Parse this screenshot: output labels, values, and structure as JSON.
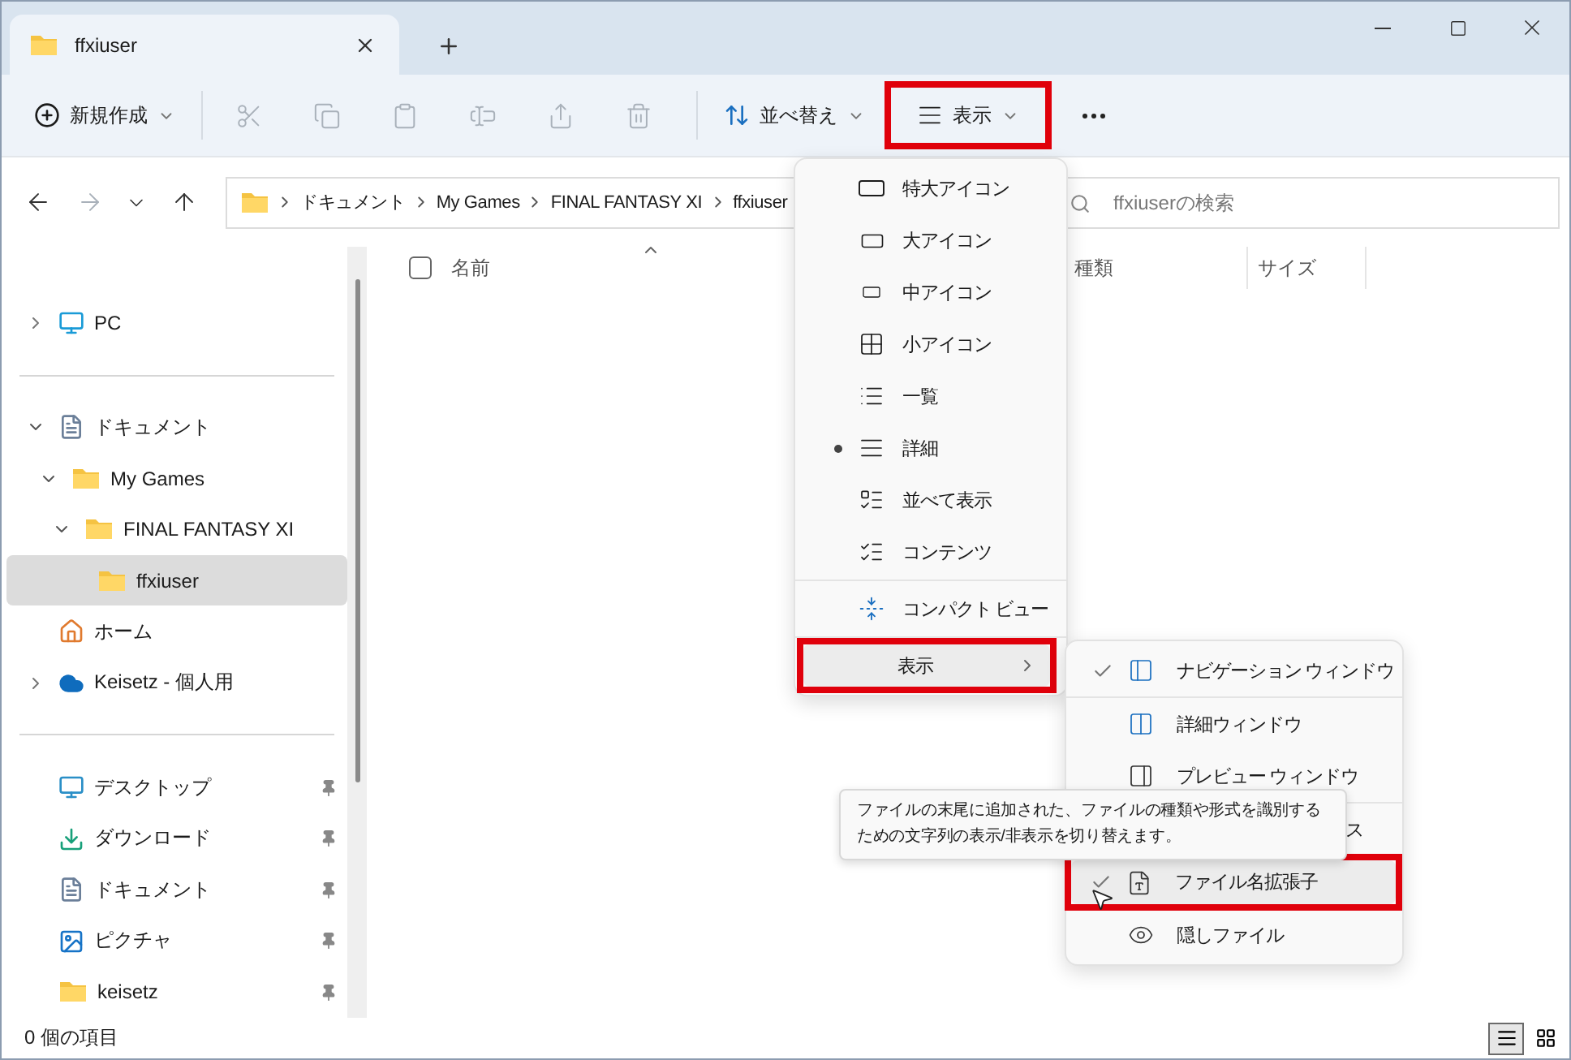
{
  "window": {
    "tab_title": "ffxiuser"
  },
  "toolbar": {
    "new_label": "新規作成",
    "actions": [
      {
        "disabled": true
      },
      {
        "disabled": true
      },
      {
        "disabled": true
      },
      {
        "disabled": true
      },
      {
        "disabled": true
      },
      {
        "disabled": true
      }
    ],
    "sort_label": "並べ替え",
    "view_label": "表示",
    "view_annotated": true
  },
  "address": {
    "crumbs": [
      "ドキュメント",
      "My Games",
      "FINAL FANTASY XI",
      "ffxiuser"
    ]
  },
  "search": {
    "placeholder": "ffxiuserの検索"
  },
  "sidebar": {
    "groups": [
      [
        {
          "kind": "pc",
          "label": "PC",
          "expanded": false,
          "selected": false
        }
      ],
      [
        {
          "kind": "documents",
          "label": "ドキュメント",
          "expanded": true,
          "selected": false,
          "children": [
            {
              "kind": "folder",
              "label": "My Games",
              "expanded": true,
              "selected": false,
              "children": [
                {
                  "kind": "folder",
                  "label": "FINAL FANTASY XI",
                  "expanded": true,
                  "selected": false,
                  "children": [
                    {
                      "kind": "folder",
                      "label": "ffxiuser",
                      "selected": true
                    }
                  ]
                }
              ]
            }
          ]
        },
        {
          "kind": "home",
          "label": "ホーム",
          "selected": false
        },
        {
          "kind": "cloud",
          "label": "Keisetz - 個人用",
          "expanded": false,
          "selected": false
        }
      ],
      [
        {
          "kind": "desktop",
          "label": "デスクトップ",
          "pinned": true,
          "selected": false
        },
        {
          "kind": "download",
          "label": "ダウンロード",
          "pinned": true,
          "selected": false
        },
        {
          "kind": "documents",
          "label": "ドキュメント",
          "pinned": true,
          "selected": false
        },
        {
          "kind": "pictures",
          "label": "ピクチャ",
          "pinned": true,
          "selected": false
        },
        {
          "kind": "folder",
          "label": "keisetz",
          "pinned": true,
          "selected": false
        }
      ]
    ]
  },
  "table": {
    "select_all_checked": false,
    "columns": [
      {
        "label": "名前",
        "sorted": true
      },
      {
        "label": "種類",
        "sorted": false
      },
      {
        "label": "サイズ",
        "sorted": false
      }
    ]
  },
  "view_menu": {
    "groups": [
      [
        {
          "label": "特大アイコン",
          "selected": false
        },
        {
          "label": "大アイコン",
          "selected": false
        },
        {
          "label": "中アイコン",
          "selected": false
        },
        {
          "label": "小アイコン",
          "selected": false
        },
        {
          "label": "一覧",
          "selected": false
        },
        {
          "label": "詳細",
          "selected": true
        },
        {
          "label": "並べて表示",
          "selected": false
        },
        {
          "label": "コンテンツ",
          "selected": false
        }
      ],
      [
        {
          "label": "コンパクト ビュー",
          "checked": false
        }
      ],
      [
        {
          "label": "表示",
          "highlighted": true,
          "annotated": true
        }
      ]
    ]
  },
  "show_submenu": {
    "groups": [
      [
        {
          "label": "ナビゲーション ウィンドウ",
          "checked": true,
          "highlighted": false,
          "annotated": false
        }
      ],
      [
        {
          "label": "詳細ウィンドウ",
          "checked": false,
          "highlighted": false,
          "annotated": false
        },
        {
          "label": "プレビュー ウィンドウ",
          "checked": false,
          "highlighted": false,
          "annotated": false
        }
      ],
      [
        {
          "kind": "covered",
          "label": "ス",
          "checked": false,
          "highlighted": false,
          "annotated": false
        },
        {
          "label": "ファイル名拡張子",
          "checked": true,
          "highlighted": true,
          "annotated": true
        },
        {
          "label": "隠しファイル",
          "checked": false,
          "highlighted": false,
          "annotated": false
        }
      ]
    ]
  },
  "tooltip": {
    "text": "ファイルの末尾に追加された、ファイルの種類や形式を識別するための文字列の表示/非表示を切り替えます。"
  },
  "status_bar": {
    "count": "0 個の項目",
    "view_buttons": [
      {
        "selected": true
      },
      {
        "selected": false
      }
    ]
  }
}
